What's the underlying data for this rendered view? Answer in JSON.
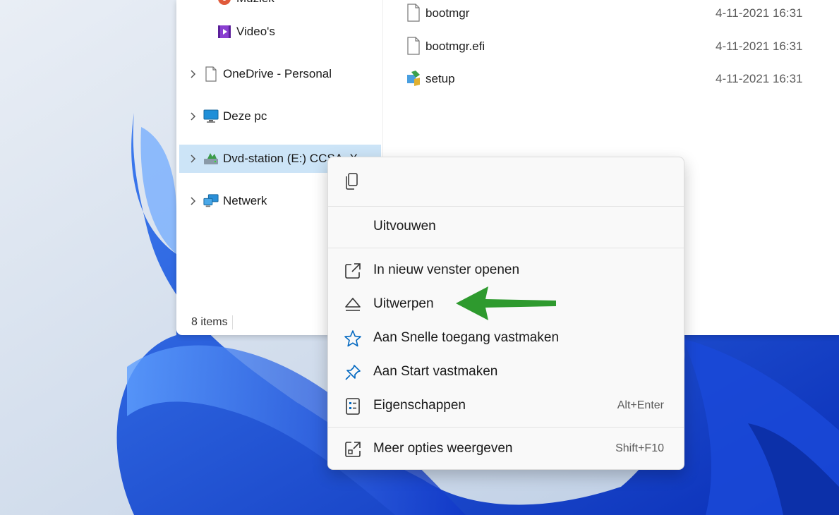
{
  "nav": {
    "items": [
      {
        "label": "Muziek"
      },
      {
        "label": "Video's"
      },
      {
        "label": "OneDrive - Personal"
      },
      {
        "label": "Deze pc"
      },
      {
        "label": "Dvd-station (E:) CCSA_X..."
      },
      {
        "label": "Netwerk"
      }
    ]
  },
  "status": {
    "count": "8 items"
  },
  "files": [
    {
      "name": "bootmgr",
      "date": "4-11-2021 16:31"
    },
    {
      "name": "bootmgr.efi",
      "date": "4-11-2021 16:31"
    },
    {
      "name": "setup",
      "date": "4-11-2021 16:31"
    }
  ],
  "menu": {
    "top_icon": "copy-icon",
    "expand": {
      "label": "Uitvouwen"
    },
    "open_new_window": {
      "label": "In nieuw venster openen",
      "icon": "open-external-icon"
    },
    "eject": {
      "label": "Uitwerpen",
      "icon": "eject-icon"
    },
    "pin_quick_access": {
      "label": "Aan Snelle toegang vastmaken",
      "icon": "star-icon"
    },
    "pin_start": {
      "label": "Aan Start vastmaken",
      "icon": "pin-icon"
    },
    "properties": {
      "label": "Eigenschappen",
      "shortcut": "Alt+Enter",
      "icon": "properties-icon"
    },
    "more_options": {
      "label": "Meer opties weergeven",
      "shortcut": "Shift+F10",
      "icon": "more-options-icon"
    }
  },
  "colors": {
    "accent": "#0067c0",
    "selection": "#cce4f7",
    "annotation_arrow": "#2e9a2e"
  }
}
